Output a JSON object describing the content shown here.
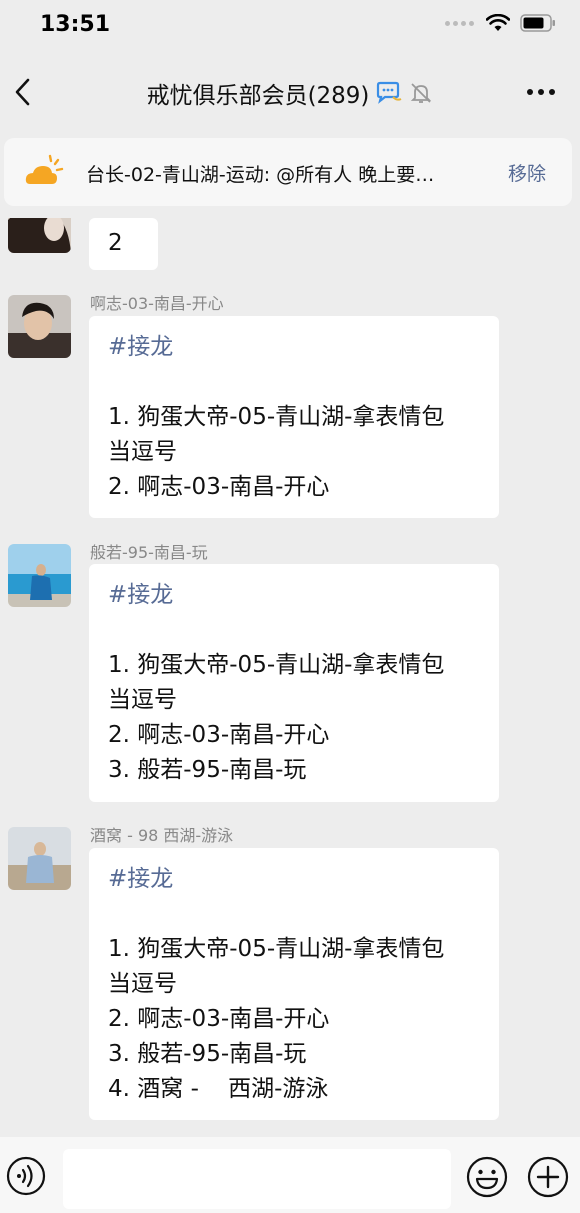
{
  "status_bar": {
    "time": "13:51"
  },
  "nav": {
    "title": "戒忧俱乐部会员(289)",
    "icons": [
      "back-icon",
      "chat-bubble-icon",
      "mute-bell-icon",
      "more-icon"
    ]
  },
  "pinned": {
    "text": "台长-02-青山湖-运动: @所有人 晚上要…",
    "remove_label": "移除"
  },
  "messages": [
    {
      "sender": "",
      "lines": [
        "2"
      ]
    },
    {
      "sender": "啊志-03-南昌-开心",
      "tag": "#接龙",
      "lines": [
        "1. 狗蛋大帝-05-青山湖-拿表情包",
        "当逗号",
        "2. 啊志-03-南昌-开心"
      ]
    },
    {
      "sender": "般若-95-南昌-玩",
      "tag": "#接龙",
      "lines": [
        "1. 狗蛋大帝-05-青山湖-拿表情包",
        "当逗号",
        "2. 啊志-03-南昌-开心",
        "3. 般若-95-南昌-玩"
      ]
    },
    {
      "sender": "酒窝 - 98 西湖-游泳",
      "tag": "#接龙",
      "lines": [
        "1. 狗蛋大帝-05-青山湖-拿表情包",
        "当逗号",
        "2. 啊志-03-南昌-开心",
        "3. 般若-95-南昌-玩",
        "4. 酒窝 -    西湖-游泳"
      ]
    }
  ],
  "input_bar": {
    "icons": [
      "voice-icon",
      "emoji-icon",
      "plus-icon"
    ]
  },
  "colors": {
    "background": "#ededed",
    "bubble": "#ffffff",
    "link_blue": "#576b95",
    "input_bar": "#f7f7f7"
  }
}
